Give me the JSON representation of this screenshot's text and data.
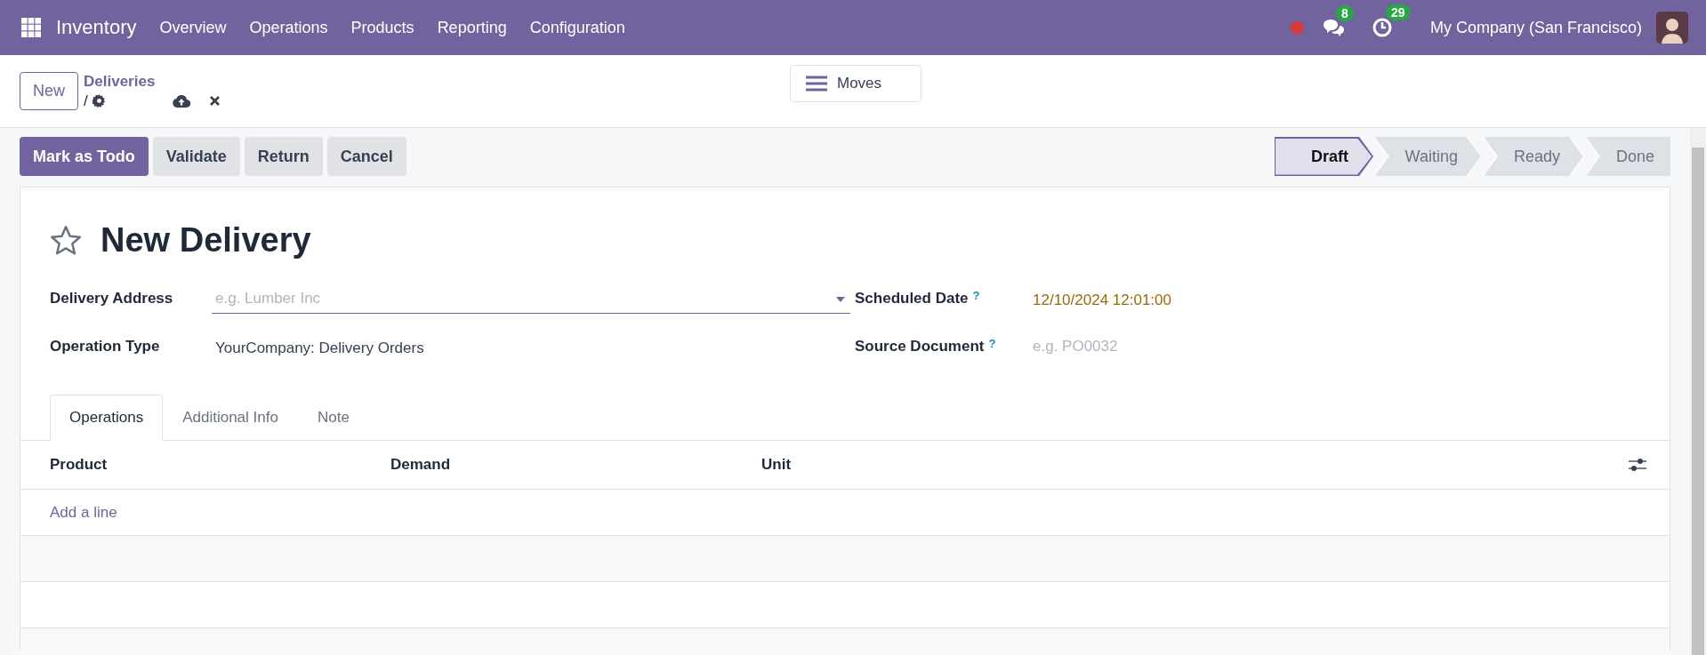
{
  "navbar": {
    "app_name": "Inventory",
    "menu": [
      "Overview",
      "Operations",
      "Products",
      "Reporting",
      "Configuration"
    ],
    "messages_count": "8",
    "activities_count": "29",
    "company": "My Company (San Francisco)"
  },
  "control_panel": {
    "new_button": "New",
    "breadcrumb": "Deliveries",
    "breadcrumb_separator": "/",
    "view_button": "Moves"
  },
  "actions": [
    {
      "label": "Mark as Todo",
      "kind": "primary"
    },
    {
      "label": "Validate",
      "kind": "secondary"
    },
    {
      "label": "Return",
      "kind": "secondary"
    },
    {
      "label": "Cancel",
      "kind": "secondary"
    }
  ],
  "stages": [
    {
      "label": "Draft",
      "selected": true
    },
    {
      "label": "Waiting",
      "selected": false
    },
    {
      "label": "Ready",
      "selected": false
    },
    {
      "label": "Done",
      "selected": false
    }
  ],
  "form": {
    "title": "New Delivery",
    "left_fields": [
      {
        "label": "Delivery Address",
        "kind": "dropdown",
        "placeholder": "e.g. Lumber Inc"
      },
      {
        "label": "Operation Type",
        "kind": "text",
        "value": "YourCompany: Delivery Orders"
      }
    ],
    "right_fields": [
      {
        "label": "Scheduled Date",
        "help": "?",
        "kind": "date",
        "value": "12/10/2024 12:01:00"
      },
      {
        "label": "Source Document",
        "help": "?",
        "kind": "text",
        "placeholder": "e.g. PO0032"
      }
    ]
  },
  "tabs": [
    {
      "label": "Operations",
      "selected": true
    },
    {
      "label": "Additional Info",
      "selected": false
    },
    {
      "label": "Note",
      "selected": false
    }
  ],
  "table": {
    "columns": [
      "Product",
      "Demand",
      "Unit"
    ],
    "add_line": "Add a line"
  }
}
